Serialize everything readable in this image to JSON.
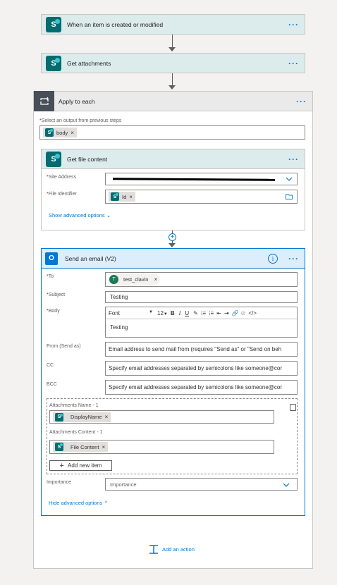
{
  "trigger": {
    "title": "When an item is created or modified"
  },
  "get_attachments": {
    "title": "Get attachments"
  },
  "apply_to_each": {
    "title": "Apply to each",
    "select_label": "Select an output from previous steps",
    "token": "body"
  },
  "get_file_content": {
    "title": "Get file content",
    "site_address_label": "Site Address",
    "file_identifier_label": "File Identifier",
    "file_identifier_token": "Id",
    "advanced_options": "Show advanced options"
  },
  "send_email": {
    "title": "Send an email (V2)",
    "to_label": "To",
    "to_token": "test_clavin",
    "to_avatar": "T",
    "subject_label": "Subject",
    "subject_value": "Testing",
    "body_label": "Body",
    "font_select": "Font",
    "font_size": "12",
    "body_value": "Testing",
    "from_label": "From (Send as)",
    "from_placeholder": "Email address to send mail from (requires \"Send as\" or \"Send on beh",
    "cc_label": "CC",
    "cc_placeholder": "Specify email addresses separated by semicolons like someone@cor",
    "bcc_label": "BCC",
    "bcc_placeholder": "Specify email addresses separated by semicolons like someone@cor",
    "attach_name_label": "Attachments Name - 1",
    "attach_name_token": "DisplayName",
    "attach_content_label": "Attachments Content - 1",
    "attach_content_token": "File Content",
    "add_new_item": "Add new item",
    "importance_label": "Importance",
    "importance_value": "Importance",
    "hide_advanced": "Hide advanced options"
  },
  "add_action": "Add an action",
  "colors": {
    "accent": "#0078d4",
    "sharepoint": "#036c70",
    "header_bg": "#dcebeb",
    "loop_bg": "#eaeaea",
    "outlook_bg": "#dceefb"
  }
}
